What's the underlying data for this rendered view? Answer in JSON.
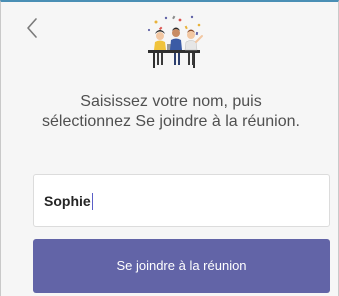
{
  "header": {
    "back_icon": "chevron-left-icon",
    "illustration_icon": "meeting-people-illustration"
  },
  "prompt": {
    "text": "Saisissez votre nom, puis sélectionnez Se joindre à la réunion."
  },
  "name_input": {
    "value": "Sophie"
  },
  "join": {
    "label": "Se joindre à la réunion"
  },
  "colors": {
    "accent": "#6264a7",
    "top_border": "#4a8fb5",
    "background": "#f6f6f6",
    "text": "#505050"
  }
}
